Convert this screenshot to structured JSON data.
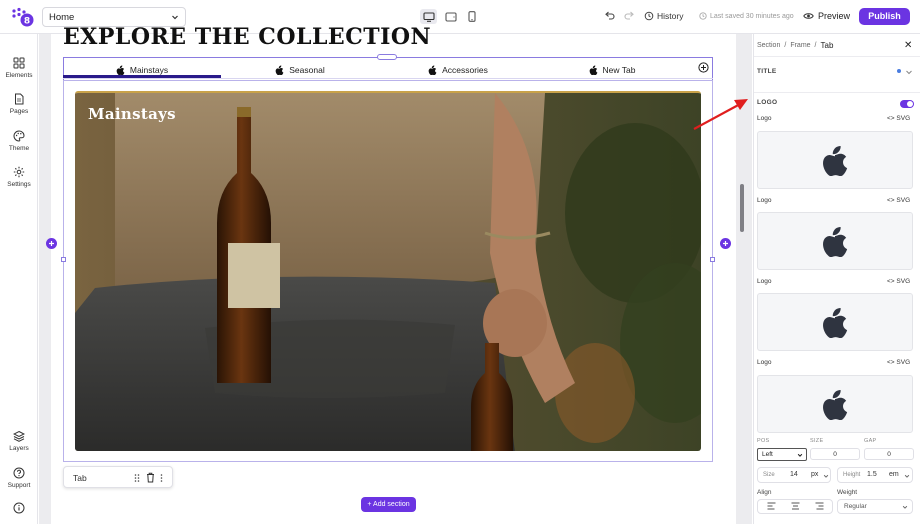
{
  "topbar": {
    "page_select": "Home",
    "history_label": "History",
    "last_saved": "Last saved 30 minutes ago",
    "preview_label": "Preview",
    "publish_label": "Publish",
    "brand_color": "#6b34e2"
  },
  "leftbar": {
    "items": [
      {
        "label": "Elements",
        "icon": "grid-icon"
      },
      {
        "label": "Pages",
        "icon": "page-icon"
      },
      {
        "label": "Theme",
        "icon": "palette-icon"
      },
      {
        "label": "Settings",
        "icon": "gear-icon"
      },
      {
        "label": "Layers",
        "icon": "layers-icon"
      },
      {
        "label": "Support",
        "icon": "help-icon"
      }
    ]
  },
  "canvas": {
    "heading": "EXPLORE THE COLLECTION",
    "tabs": [
      {
        "label": "Mainstays",
        "active": true
      },
      {
        "label": "Seasonal",
        "active": false
      },
      {
        "label": "Accessories",
        "active": false
      },
      {
        "label": "New Tab",
        "active": false
      }
    ],
    "hero_title": "Mainstays",
    "selected_chip": "Tab",
    "add_section": "+ Add section"
  },
  "panel": {
    "breadcrumb": [
      "Section",
      "Frame",
      "Tab"
    ],
    "title_section": "TITLE",
    "logo_section": "LOGO",
    "logo_toggle_on": true,
    "logos": [
      {
        "label": "Logo",
        "type": "SVG"
      },
      {
        "label": "Logo",
        "type": "SVG"
      },
      {
        "label": "Logo",
        "type": "SVG"
      },
      {
        "label": "Logo",
        "type": "SVG"
      }
    ],
    "pos_label": "POS",
    "size_label": "SIZE",
    "gap_label": "GAP",
    "pos_value": "Left",
    "size_value": "0",
    "gap_value": "0",
    "size_field_label": "Size",
    "size_field_value": "14",
    "size_unit": "px",
    "height_field_label": "Height",
    "height_field_value": "1.5",
    "height_unit": "em",
    "align_label": "Align",
    "weight_label": "Weight",
    "weight_value": "Regular"
  }
}
